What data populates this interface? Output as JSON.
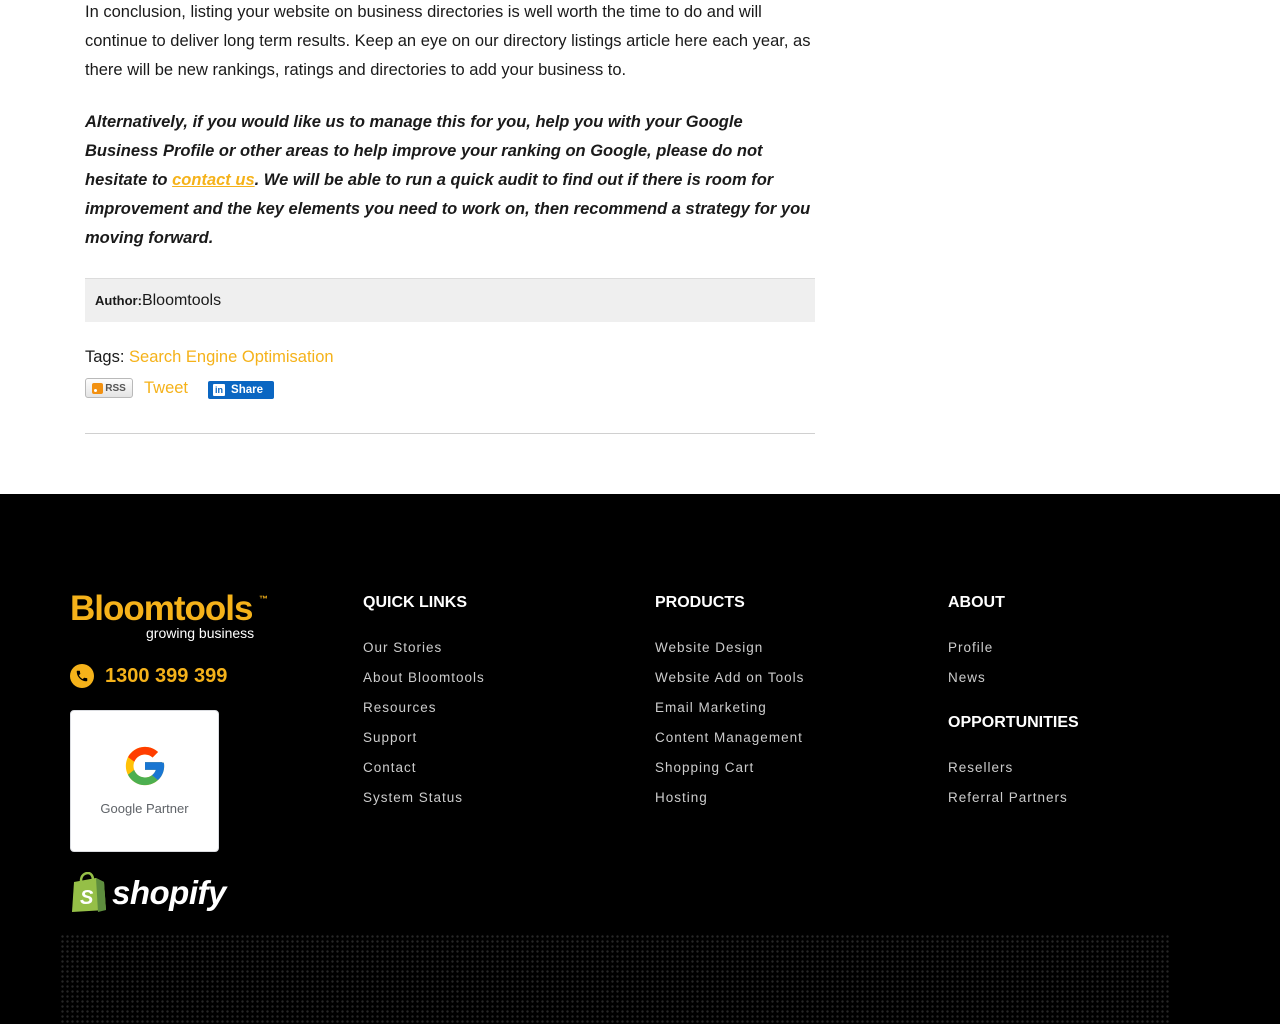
{
  "article": {
    "conclusion": "In conclusion, listing your website on business directories is well worth the time to do and will continue to deliver long term results.  Keep an eye on our directory listings article here each year, as there will be new rankings, ratings and directories to add your business to.",
    "cta_before": "Alternatively, if you would like us to manage this for you, help you with your Google Business Profile or other areas to help improve your ranking on Google, please do not hesitate to ",
    "cta_link": "contact us",
    "cta_after": ".  We will be able to run a quick audit to find out if there is room for improvement and the key elements you need to work on, then recommend a strategy for you moving forward.",
    "author_label": "Author:",
    "author_name": "Bloomtools",
    "tags_label": "Tags:",
    "tag": "Search Engine Optimisation",
    "rss_label": "RSS",
    "tweet_label": "Tweet",
    "share_label": "Share"
  },
  "footer": {
    "logo_text": "Bloomtools",
    "logo_tm": "™",
    "logo_tagline": "growing business",
    "phone": "1300 399 399",
    "google_partner": "Google Partner",
    "shopify": "shopify",
    "quick_links": {
      "heading": "QUICK LINKS",
      "items": [
        "Our Stories",
        "About Bloomtools",
        "Resources",
        "Support",
        "Contact",
        "System Status"
      ]
    },
    "products": {
      "heading": "PRODUCTS",
      "items": [
        "Website Design",
        "Website Add on Tools",
        "Email Marketing",
        "Content Management",
        "Shopping Cart",
        "Hosting"
      ]
    },
    "about": {
      "heading": "ABOUT",
      "items": [
        "Profile",
        "News"
      ]
    },
    "opportunities": {
      "heading": "OPPORTUNITIES",
      "items": [
        "Resellers",
        "Referral Partners"
      ]
    }
  },
  "colors": {
    "accent": "#f5b21a",
    "footer_bg": "#000000",
    "linkedin": "#0a66c2"
  }
}
